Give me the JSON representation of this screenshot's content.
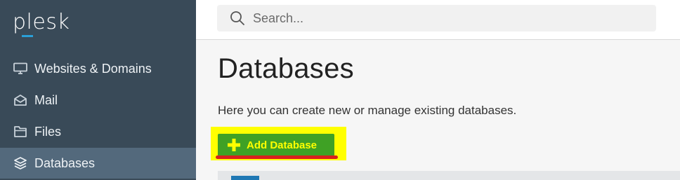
{
  "brand": {
    "logo_text": "plesk",
    "accent_color": "#2aa0d8"
  },
  "sidebar": {
    "background": "#394a58",
    "items": [
      {
        "label": "Websites & Domains",
        "icon": "monitor-icon",
        "active": false
      },
      {
        "label": "Mail",
        "icon": "envelope-icon",
        "active": false
      },
      {
        "label": "Files",
        "icon": "folder-icon",
        "active": false
      },
      {
        "label": "Databases",
        "icon": "layers-icon",
        "active": true
      }
    ]
  },
  "search": {
    "placeholder": "Search...",
    "value": ""
  },
  "main": {
    "title": "Databases",
    "description": "Here you can create new or manage existing databases.",
    "add_button": {
      "label": "Add Database",
      "icon": "plus-icon",
      "color": "#3fa125",
      "label_color": "#ffff00"
    },
    "annotation": {
      "highlight_color": "#ffff00",
      "underline_color": "#d8211c"
    }
  }
}
